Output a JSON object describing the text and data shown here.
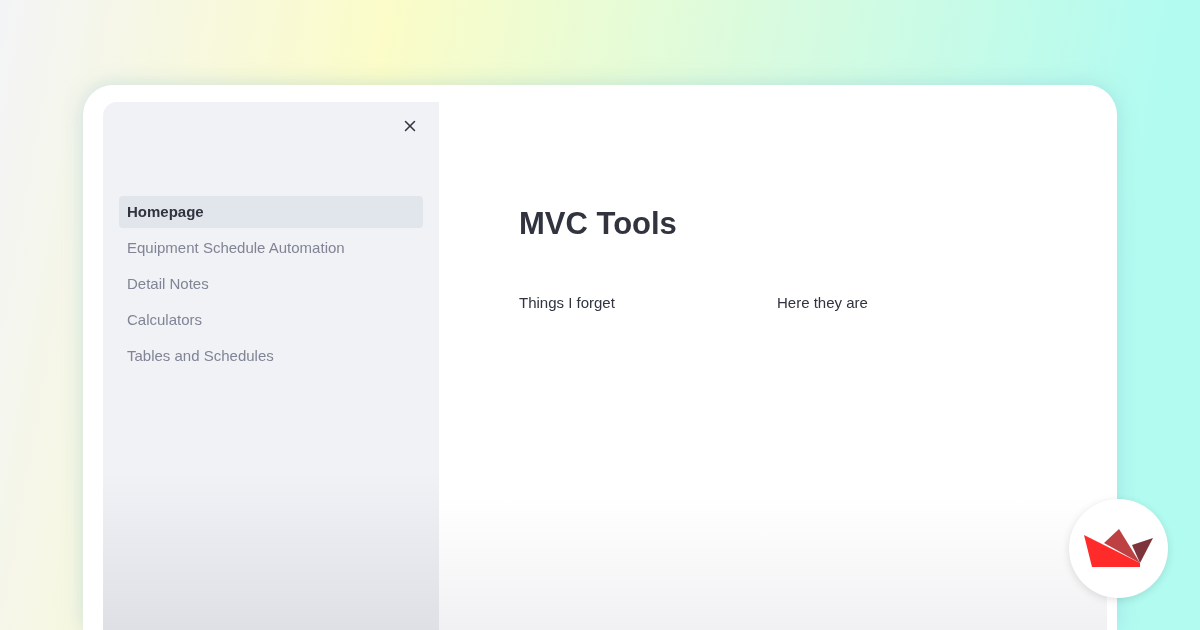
{
  "sidebar": {
    "items": [
      {
        "label": "Homepage",
        "selected": true
      },
      {
        "label": "Equipment Schedule Automation",
        "selected": false
      },
      {
        "label": "Detail Notes",
        "selected": false
      },
      {
        "label": "Calculators",
        "selected": false
      },
      {
        "label": "Tables and Schedules",
        "selected": false
      }
    ]
  },
  "main": {
    "title": "MVC Tools",
    "columns": [
      "Things I forget",
      "Here they are"
    ]
  }
}
